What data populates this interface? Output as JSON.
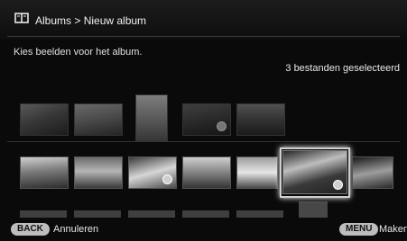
{
  "header": {
    "breadcrumb": "Albums > Nieuw album",
    "icon": "album-book-icon"
  },
  "prompt": "Kies beelden voor het album.",
  "selection_count": "3 bestanden geselecteerd",
  "footer": {
    "back_key": "BACK",
    "back_label": "Annuleren",
    "menu_key": "MENU",
    "menu_label": "Maken"
  },
  "colors": {
    "background": "#0a0a0a",
    "text": "#e8e8e8",
    "key_button": "#bdbdbd"
  }
}
